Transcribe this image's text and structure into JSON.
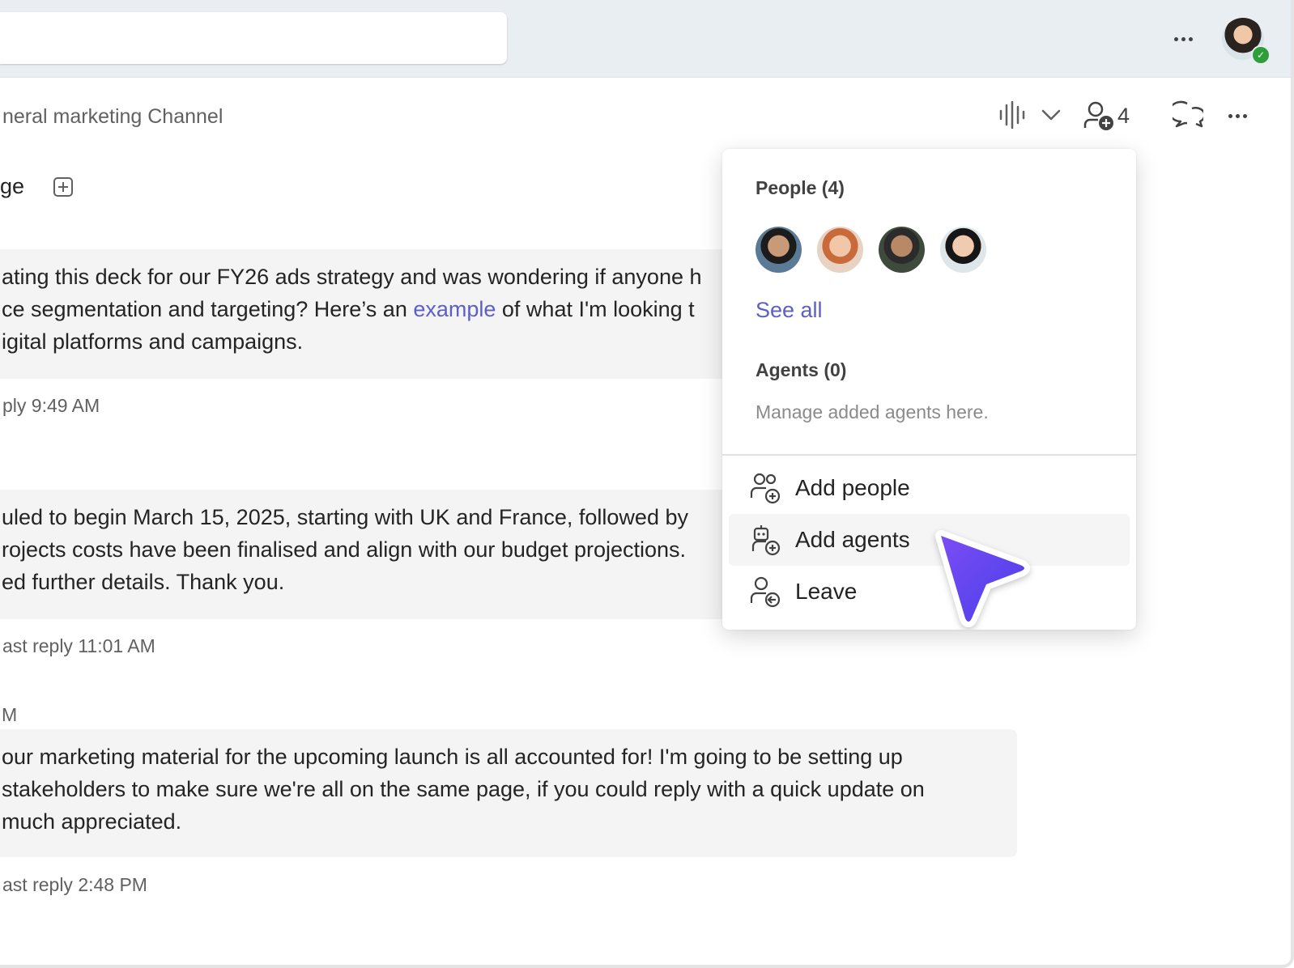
{
  "header": {
    "search_value": "",
    "channel_title": "neral marketing Channel",
    "member_count": "4",
    "tab_label": "ge"
  },
  "messages": [
    {
      "lines": [
        {
          "parts": [
            {
              "text": "ating this deck for our FY26 ads strategy and was wondering if anyone h"
            }
          ]
        },
        {
          "parts": [
            {
              "text": "ce segmentation and targeting? Here’s an "
            },
            {
              "text": "example",
              "link": true
            },
            {
              "text": " of what I'm looking t"
            }
          ]
        },
        {
          "parts": [
            {
              "text": "igital platforms and campaigns."
            }
          ]
        }
      ],
      "meta": "ply 9:49 AM"
    },
    {
      "lines": [
        {
          "parts": [
            {
              "text": "uled to begin March 15, 2025, starting with UK and France, followed by"
            }
          ]
        },
        {
          "parts": [
            {
              "text": "rojects costs have been finalised and align with our budget projections."
            }
          ]
        },
        {
          "parts": [
            {
              "text": "ed further details. Thank you."
            }
          ]
        }
      ],
      "meta": "ast reply 11:01 AM"
    },
    {
      "sender_time": "M",
      "lines": [
        {
          "parts": [
            {
              "text": " our marketing material for the upcoming launch is all accounted for! I'm going to be setting up"
            }
          ]
        },
        {
          "parts": [
            {
              "text": "stakeholders to make sure we're all on the same page, if you could reply with a quick update on"
            }
          ]
        },
        {
          "parts": [
            {
              "text": "much appreciated."
            }
          ]
        }
      ],
      "meta": "ast reply 2:48 PM"
    }
  ],
  "popover": {
    "people_title": "People (4)",
    "people_avatars": [
      {
        "icon": "person-avatar-1",
        "bg": "#5a7a95",
        "skin": "#c99a78",
        "hair": "#1c1c1c"
      },
      {
        "icon": "person-avatar-2",
        "bg": "#e8d2c2",
        "skin": "#f1c6a9",
        "hair": "#c86a3a"
      },
      {
        "icon": "person-avatar-3",
        "bg": "#3d4a3c",
        "skin": "#b98866",
        "hair": "#2b2b2b"
      },
      {
        "icon": "person-avatar-4",
        "bg": "#dfe6ea",
        "skin": "#f0cbb0",
        "hair": "#161616"
      }
    ],
    "see_all": "See all",
    "agents_title": "Agents (0)",
    "agents_note": "Manage added agents here.",
    "menu": [
      {
        "label": "Add people",
        "icon": "add-people-icon"
      },
      {
        "label": "Add agents",
        "icon": "add-agents-icon"
      },
      {
        "label": "Leave",
        "icon": "leave-icon"
      }
    ]
  },
  "colors": {
    "accent": "#5b5fc7",
    "cursor_from": "#7b4cf5",
    "cursor_to": "#4a3fe8",
    "presence": "#2e9e3a"
  }
}
